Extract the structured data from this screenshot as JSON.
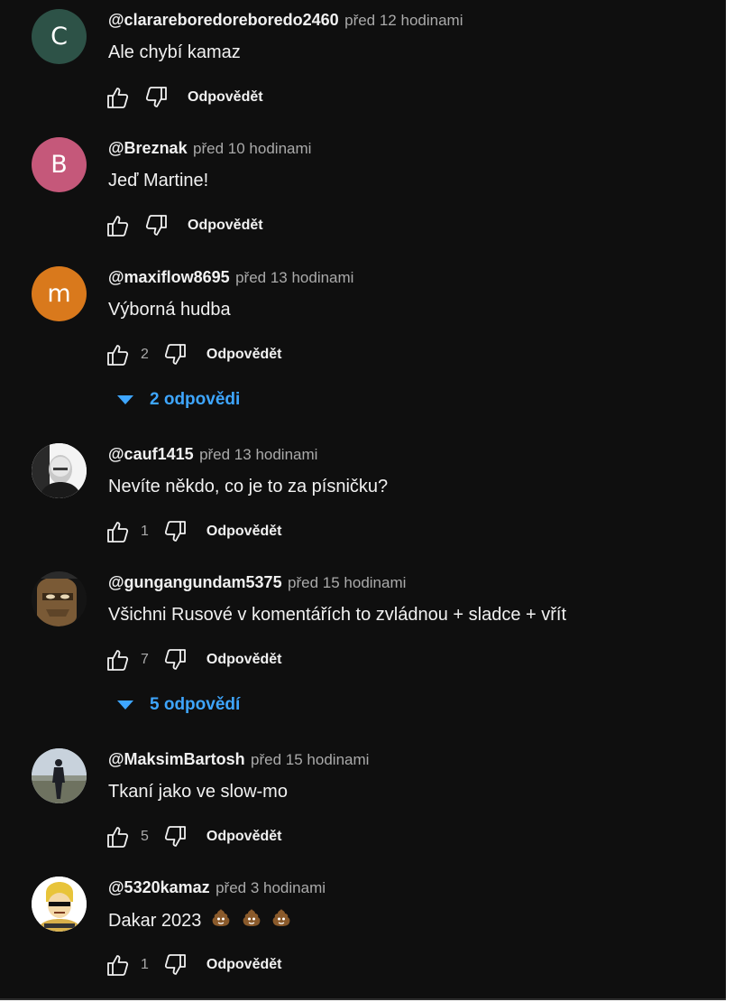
{
  "reply_label": "Odpovědět",
  "colors": {
    "accent": "#3ea6ff",
    "background": "#0f0f0f",
    "text": "#f1f1f1",
    "muted": "#aaaaaa"
  },
  "comments": [
    {
      "author": "@clarareboredoreboredo2460",
      "time": "před 12 hodinami",
      "text": "Ale chybí kamaz",
      "likes": "",
      "avatar_letter": "C",
      "avatar_color": "#2d5247"
    },
    {
      "author": "@Breznak",
      "time": "před 10 hodinami",
      "text": "Jeď Martine!",
      "likes": "",
      "avatar_letter": "B",
      "avatar_color": "#c5587a"
    },
    {
      "author": "@maxiflow8695",
      "time": "před 13 hodinami",
      "text": "Výborná hudba",
      "likes": "2",
      "avatar_letter": "m",
      "avatar_color": "#d9791c",
      "replies": "2 odpovědi"
    },
    {
      "author": "@cauf1415",
      "time": "před 13 hodinami",
      "text": "Nevíte někdo, co je to za písničku?",
      "likes": "1",
      "avatar_icon": "portrait-photo"
    },
    {
      "author": "@gungangundam5375",
      "time": "před 15 hodinami",
      "text": "Všichni Rusové v komentářích to zvládnou + sladce + vřít",
      "likes": "7",
      "avatar_icon": "masked-face-art",
      "replies": "5 odpovědí"
    },
    {
      "author": "@MaksimBartosh",
      "time": "před 15 hodinami",
      "text": "Tkaní jako ve slow-mo",
      "likes": "5",
      "avatar_icon": "landscape-silhouette"
    },
    {
      "author": "@5320kamaz",
      "time": "před 3 hodinami",
      "text": "Dakar 2023",
      "likes": "1",
      "avatar_icon": "cartoon-meme",
      "emoji_count": 3
    }
  ]
}
